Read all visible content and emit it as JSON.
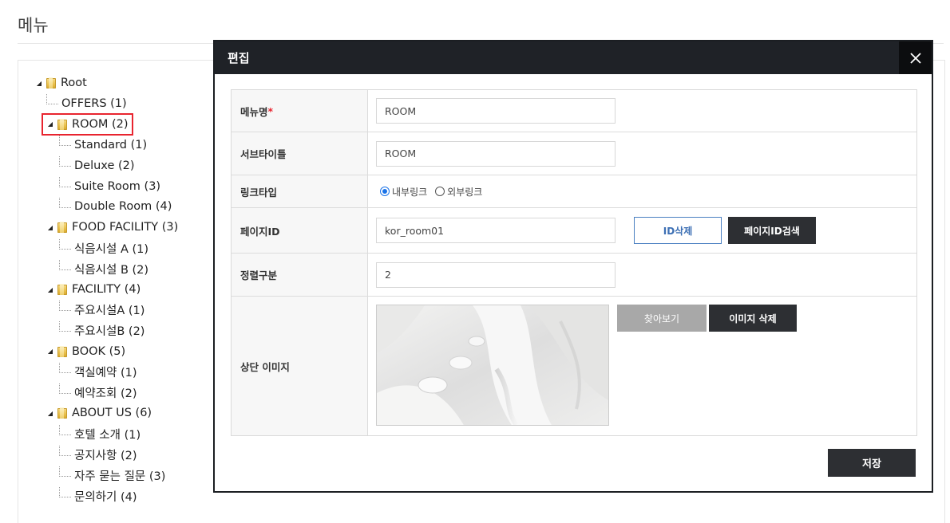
{
  "page": {
    "title": "메뉴"
  },
  "tree": {
    "nodes": [
      {
        "label": "Root",
        "type": "folder",
        "level": 0
      },
      {
        "label": "OFFERS (1)",
        "type": "leaf",
        "level": 1
      },
      {
        "label": "ROOM (2)",
        "type": "folder",
        "level": 1,
        "selected": true
      },
      {
        "label": "Standard (1)",
        "type": "leaf",
        "level": 2
      },
      {
        "label": "Deluxe (2)",
        "type": "leaf",
        "level": 2
      },
      {
        "label": "Suite Room (3)",
        "type": "leaf",
        "level": 2
      },
      {
        "label": "Double Room (4)",
        "type": "leaf",
        "level": 2
      },
      {
        "label": "FOOD FACILITY (3)",
        "type": "folder",
        "level": 1
      },
      {
        "label": "식음시설 A (1)",
        "type": "leaf",
        "level": 2
      },
      {
        "label": "식음시설 B (2)",
        "type": "leaf",
        "level": 2
      },
      {
        "label": "FACILITY (4)",
        "type": "folder",
        "level": 1
      },
      {
        "label": "주요시설A (1)",
        "type": "leaf",
        "level": 2
      },
      {
        "label": "주요시설B (2)",
        "type": "leaf",
        "level": 2
      },
      {
        "label": "BOOK (5)",
        "type": "folder",
        "level": 1
      },
      {
        "label": "객실예약 (1)",
        "type": "leaf",
        "level": 2
      },
      {
        "label": "예약조회 (2)",
        "type": "leaf",
        "level": 2
      },
      {
        "label": "ABOUT US (6)",
        "type": "folder",
        "level": 1
      },
      {
        "label": "호텔 소개 (1)",
        "type": "leaf",
        "level": 2
      },
      {
        "label": "공지사항 (2)",
        "type": "leaf",
        "level": 2
      },
      {
        "label": "자주 묻는 질문 (3)",
        "type": "leaf",
        "level": 2
      },
      {
        "label": "문의하기 (4)",
        "type": "leaf",
        "level": 2
      }
    ]
  },
  "modal": {
    "title": "편집",
    "fields": {
      "menu_name": {
        "label": "메뉴명",
        "required_mark": "*",
        "value": "ROOM"
      },
      "subtitle": {
        "label": "서브타이틀",
        "value": "ROOM"
      },
      "link_type": {
        "label": "링크타입",
        "options": [
          "내부링크",
          "외부링크"
        ],
        "selected": "내부링크"
      },
      "page_id": {
        "label": "페이지ID",
        "value": "kor_room01",
        "delete_btn": "ID삭제",
        "search_btn": "페이지ID검색"
      },
      "sort_order": {
        "label": "정렬구분",
        "value": "2"
      },
      "top_image": {
        "label": "상단 이미지",
        "browse_btn": "찾아보기",
        "delete_btn": "이미지 삭제"
      }
    },
    "save_label": "저장"
  },
  "colors": {
    "modal_header": "#1f2227",
    "selected_outline": "#e8242f",
    "required": "#e8242f",
    "radio_accent": "#1a73e8",
    "dark_button": "#2d2f33",
    "outline_button": "#3c6fb4"
  }
}
